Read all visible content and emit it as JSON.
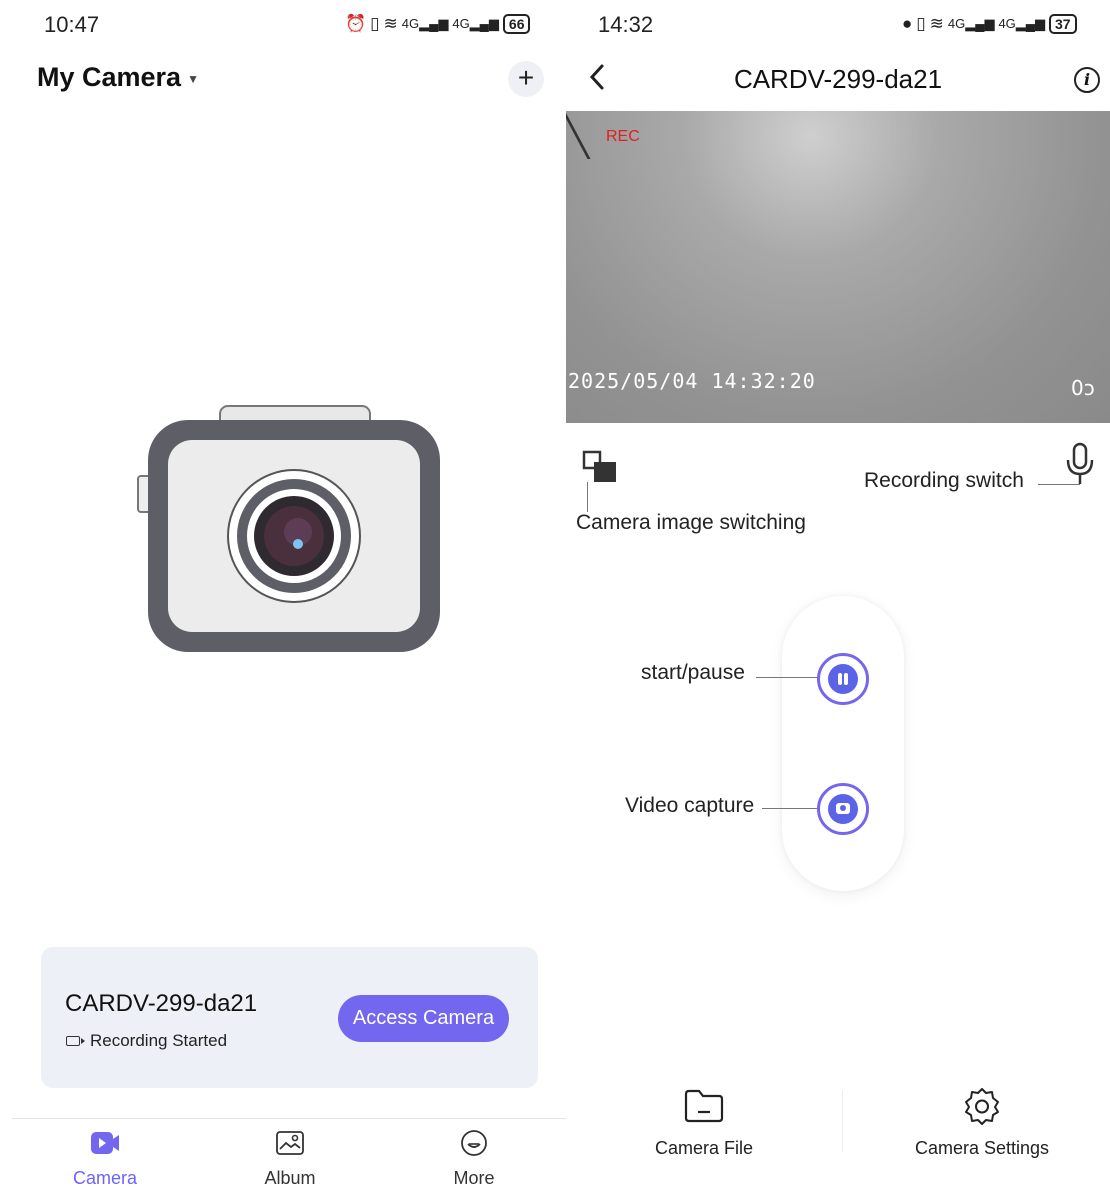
{
  "left_screen": {
    "status_bar": {
      "time": "10:47",
      "battery": "66"
    },
    "header": {
      "title": "My Camera",
      "add_label": "+"
    },
    "device_card": {
      "name": "CARDV-299-da21",
      "status": "Recording Started",
      "button_label": "Access Camera"
    },
    "tab_bar": {
      "tabs": [
        {
          "label": "Camera",
          "icon": "video-camera-icon",
          "active": true
        },
        {
          "label": "Album",
          "icon": "image-icon",
          "active": false
        },
        {
          "label": "More",
          "icon": "smile-icon",
          "active": false
        }
      ]
    }
  },
  "right_screen": {
    "status_bar": {
      "time": "14:32",
      "battery": "37"
    },
    "header": {
      "title": "CARDV-299-da21",
      "back_icon": "chevron-left-icon",
      "info_icon": "info-icon"
    },
    "video": {
      "rec_label": "REC",
      "timestamp": "2025/05/04  14:32:20",
      "corner_label": "0ɔ"
    },
    "annotations": {
      "camera_switch": "Camera image switching",
      "recording_switch": "Recording switch",
      "start_pause": "start/pause",
      "video_capture": "Video capture"
    },
    "bottom_actions": [
      {
        "label": "Camera File",
        "icon": "folder-icon"
      },
      {
        "label": "Camera Settings",
        "icon": "gear-icon"
      }
    ]
  },
  "colors": {
    "accent": "#7367f0",
    "card_bg": "#eef0f8",
    "rec_red": "#e02020"
  }
}
